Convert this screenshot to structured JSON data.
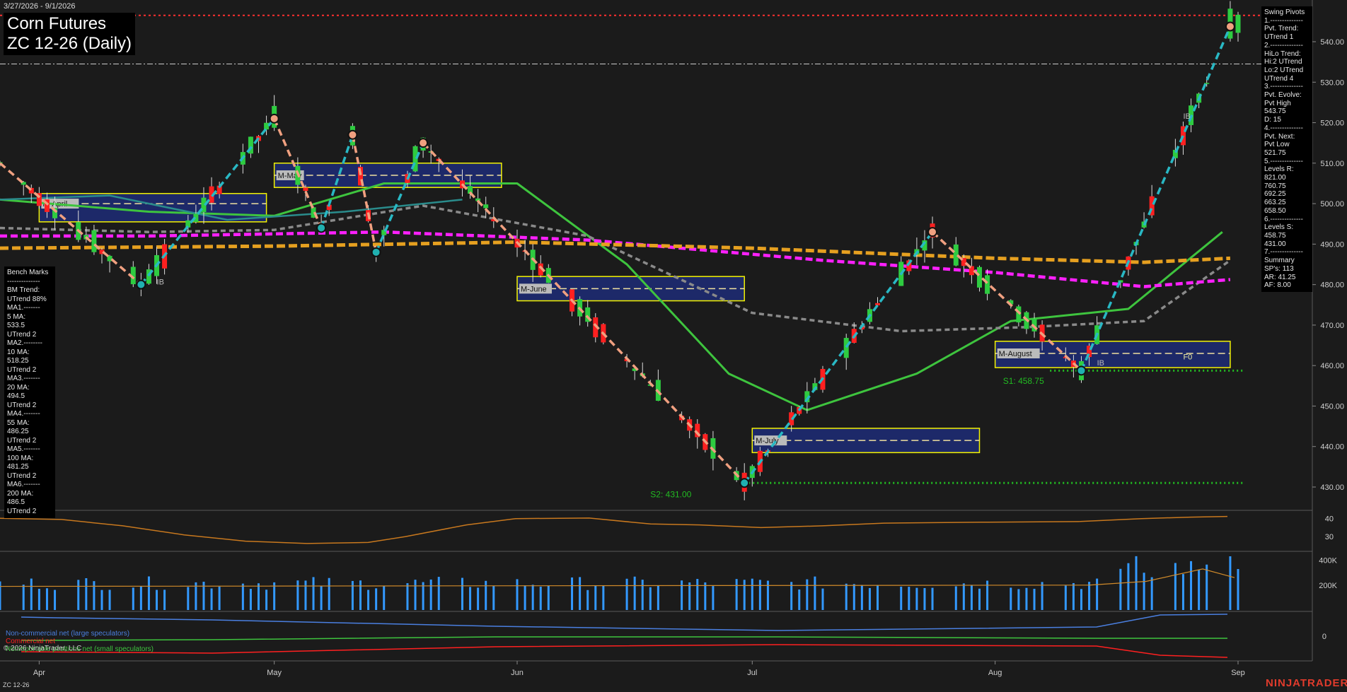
{
  "header": {
    "date_range": "3/27/2026 - 9/1/2026",
    "instrument": "Corn Futures",
    "symbol_title": "ZC 12-26 (Daily)"
  },
  "bench_marks": [
    "Bench Marks",
    "--------------",
    "BM Trend:",
    "UTrend 88%",
    "MA1.-------",
    "5 MA:",
    "533.5",
    "UTrend 2",
    "MA2.--------",
    "10 MA:",
    "518.25",
    "UTrend 2",
    "MA3.-------",
    "20 MA:",
    "494.5",
    "UTrend 2",
    "MA4.-------",
    "55 MA:",
    "486.25",
    "UTrend 2",
    "MA5.-------",
    "100 MA:",
    "481.25",
    "UTrend 2",
    "MA6.-------",
    "200 MA:",
    "486.5",
    "UTrend 2"
  ],
  "swing_pivots": [
    "Swing Pivots",
    "1.--------------",
    "Pvt. Trend:",
    "UTrend 1",
    "2.--------------",
    "HiLo Trend:",
    "Hi:2 UTrend",
    "Lo:2 UTrend",
    "UTrend 4",
    "3.--------------",
    "Pvt. Evolve:",
    "Pvt High",
    "543.75",
    "D: 15",
    "4.--------------",
    "Pvt. Next:",
    "Pvt Low",
    "521.75",
    "5.--------------",
    "Levels R:",
    "821.00",
    "760.75",
    "692.25",
    "663.25",
    "658.50",
    "6.--------------",
    "Levels S:",
    "458.75",
    "431.00",
    "7.--------------",
    "Summary",
    "SP's: 113",
    "AR: 41.25",
    "AF: 8.00"
  ],
  "legend": {
    "noncommercial": "Non-commercial net (large speculators)",
    "commercial": "Commercial net",
    "nonreportable": "Nonreportable positions net (small speculators)"
  },
  "copyright": "© 2026 NinjaTrader, LLC",
  "symbol_bottom": "ZC 12-26",
  "brand": "NINJATRADER",
  "colors": {
    "background": "#1b1b1b",
    "up_candle": "#2ecc40",
    "down_candle": "#ff2020",
    "ma_green": "#3ec43e",
    "ma_gray": "#8a8a8a",
    "ma_magenta": "#ff20ff",
    "ma_orange": "#e6a020",
    "ma_teal": "#2a8c8c",
    "swing_up": "#29b8c4",
    "swing_down": "#f0a080",
    "box_border": "#ffff00",
    "box_fill": "#1e2a6e",
    "resistance": "#ff3030",
    "support": "#22bb22",
    "adx_line": "#c8781e",
    "volume": "#3399ff",
    "volume_avg": "#d08a2a",
    "cot_noncommercial": "#4a7fe0",
    "cot_commercial": "#ff2020",
    "cot_nonreportable": "#3ec43e"
  },
  "chart_data": {
    "type": "candlestick",
    "x_axis": {
      "ticks": [
        "Apr",
        "May",
        "Jun",
        "Jul",
        "Aug",
        "Sep"
      ],
      "tick_dates": [
        "2026-04-01",
        "2026-05-01",
        "2026-06-01",
        "2026-07-01",
        "2026-08-01",
        "2026-09-01"
      ]
    },
    "y_axis": {
      "ticks": [
        "540.00",
        "530.00",
        "520.00",
        "510.00",
        "500.00",
        "490.00",
        "480.00",
        "470.00",
        "460.00",
        "450.00",
        "440.00",
        "430.00"
      ],
      "ylim": [
        428,
        548
      ]
    },
    "key_values": {
      "pivot_high": 543.75,
      "pivot_low_next": 521.75,
      "swing_low_june_end": 431.0,
      "swing_low_august": 458.75,
      "resistance_level": 546.5,
      "dashdot_level": 534.5
    },
    "labels": {
      "s1": "S1: 458.75",
      "s2": "S2: 431.00",
      "months": [
        "M-April",
        "M-May",
        "M-June",
        "M-July",
        "M-August"
      ],
      "ib": "IB",
      "f0": "F0"
    },
    "month_boxes": [
      {
        "label": "M-April",
        "start": "2026-04-01",
        "end": "2026-04-30",
        "high": 502.5,
        "low": 495.5,
        "mid": 500.0
      },
      {
        "label": "M-May",
        "start": "2026-05-01",
        "end": "2026-05-30",
        "high": 510.0,
        "low": 504.0,
        "mid": 507.0
      },
      {
        "label": "M-June",
        "start": "2026-06-01",
        "end": "2026-06-30",
        "high": 482.0,
        "low": 476.0,
        "mid": 479.0
      },
      {
        "label": "M-July",
        "start": "2026-07-01",
        "end": "2026-07-30",
        "high": 444.5,
        "low": 438.5,
        "mid": 441.5
      },
      {
        "label": "M-August",
        "start": "2026-08-01",
        "end": "2026-08-31",
        "high": 466.0,
        "low": 459.5,
        "mid": 463.0
      }
    ],
    "zigzag": [
      {
        "date": "2026-03-27",
        "price": 510
      },
      {
        "date": "2026-04-14",
        "price": 480
      },
      {
        "date": "2026-05-01",
        "price": 521
      },
      {
        "date": "2026-05-07",
        "price": 494
      },
      {
        "date": "2026-05-11",
        "price": 517
      },
      {
        "date": "2026-05-14",
        "price": 488
      },
      {
        "date": "2026-05-20",
        "price": 515
      },
      {
        "date": "2026-06-30",
        "price": 431
      },
      {
        "date": "2026-07-24",
        "price": 493
      },
      {
        "date": "2026-08-12",
        "price": 458.75
      },
      {
        "date": "2026-08-31",
        "price": 543.75
      }
    ],
    "ma": [
      {
        "name": "20 MA",
        "points": [
          [
            "2026-03-27",
            501
          ],
          [
            "2026-04-15",
            498
          ],
          [
            "2026-05-01",
            497
          ],
          [
            "2026-05-15",
            505
          ],
          [
            "2026-06-01",
            505
          ],
          [
            "2026-06-15",
            485
          ],
          [
            "2026-06-28",
            458
          ],
          [
            "2026-07-08",
            449
          ],
          [
            "2026-07-22",
            458
          ],
          [
            "2026-08-03",
            471
          ],
          [
            "2026-08-18",
            474
          ],
          [
            "2026-08-30",
            493
          ]
        ]
      },
      {
        "name": "55 MA",
        "points": [
          [
            "2026-03-27",
            494
          ],
          [
            "2026-04-15",
            493
          ],
          [
            "2026-05-01",
            493.5
          ],
          [
            "2026-05-20",
            499.5
          ],
          [
            "2026-06-10",
            492
          ],
          [
            "2026-07-01",
            473
          ],
          [
            "2026-07-20",
            468.5
          ],
          [
            "2026-08-05",
            469.5
          ],
          [
            "2026-08-20",
            471
          ],
          [
            "2026-08-31",
            486
          ]
        ]
      },
      {
        "name": "100 MA",
        "points": [
          [
            "2026-03-27",
            492
          ],
          [
            "2026-04-15",
            492
          ],
          [
            "2026-05-15",
            493
          ],
          [
            "2026-06-10",
            491
          ],
          [
            "2026-07-10",
            486
          ],
          [
            "2026-08-01",
            483
          ],
          [
            "2026-08-20",
            479.5
          ],
          [
            "2026-08-31",
            481.25
          ]
        ]
      },
      {
        "name": "200 MA",
        "points": [
          [
            "2026-03-27",
            489
          ],
          [
            "2026-05-01",
            489.5
          ],
          [
            "2026-06-01",
            490.5
          ],
          [
            "2026-07-01",
            489
          ],
          [
            "2026-08-01",
            486.5
          ],
          [
            "2026-08-20",
            485.5
          ],
          [
            "2026-08-31",
            486.5
          ]
        ]
      },
      {
        "name": "MA teal",
        "points": [
          [
            "2026-03-27",
            501
          ],
          [
            "2026-04-10",
            502
          ],
          [
            "2026-04-25",
            496
          ],
          [
            "2026-05-10",
            498
          ],
          [
            "2026-05-25",
            501
          ]
        ]
      }
    ],
    "adx": {
      "yticks": [
        "40",
        "30"
      ],
      "ylim": [
        25,
        43
      ],
      "values": [
        [
          0,
          40.2
        ],
        [
          0.05,
          39.5
        ],
        [
          0.1,
          36
        ],
        [
          0.15,
          31
        ],
        [
          0.2,
          27.5
        ],
        [
          0.25,
          26.2
        ],
        [
          0.3,
          26.8
        ],
        [
          0.33,
          30
        ],
        [
          0.38,
          36.5
        ],
        [
          0.42,
          40
        ],
        [
          0.48,
          40.3
        ],
        [
          0.53,
          37
        ],
        [
          0.57,
          36.5
        ],
        [
          0.62,
          35
        ],
        [
          0.67,
          36
        ],
        [
          0.72,
          37.5
        ],
        [
          0.8,
          38
        ],
        [
          0.88,
          38.4
        ],
        [
          0.93,
          40
        ],
        [
          0.97,
          40.8
        ],
        [
          1,
          41.2
        ]
      ]
    },
    "volume": {
      "yticks": [
        "400K",
        "200K"
      ],
      "ylim": [
        0,
        460000
      ]
    },
    "cot": {
      "yticks": [
        "0"
      ],
      "series": [
        {
          "name": "Non-commercial net (large speculators)"
        },
        {
          "name": "Commercial net"
        },
        {
          "name": "Nonreportable positions net (small speculators)"
        }
      ]
    }
  }
}
